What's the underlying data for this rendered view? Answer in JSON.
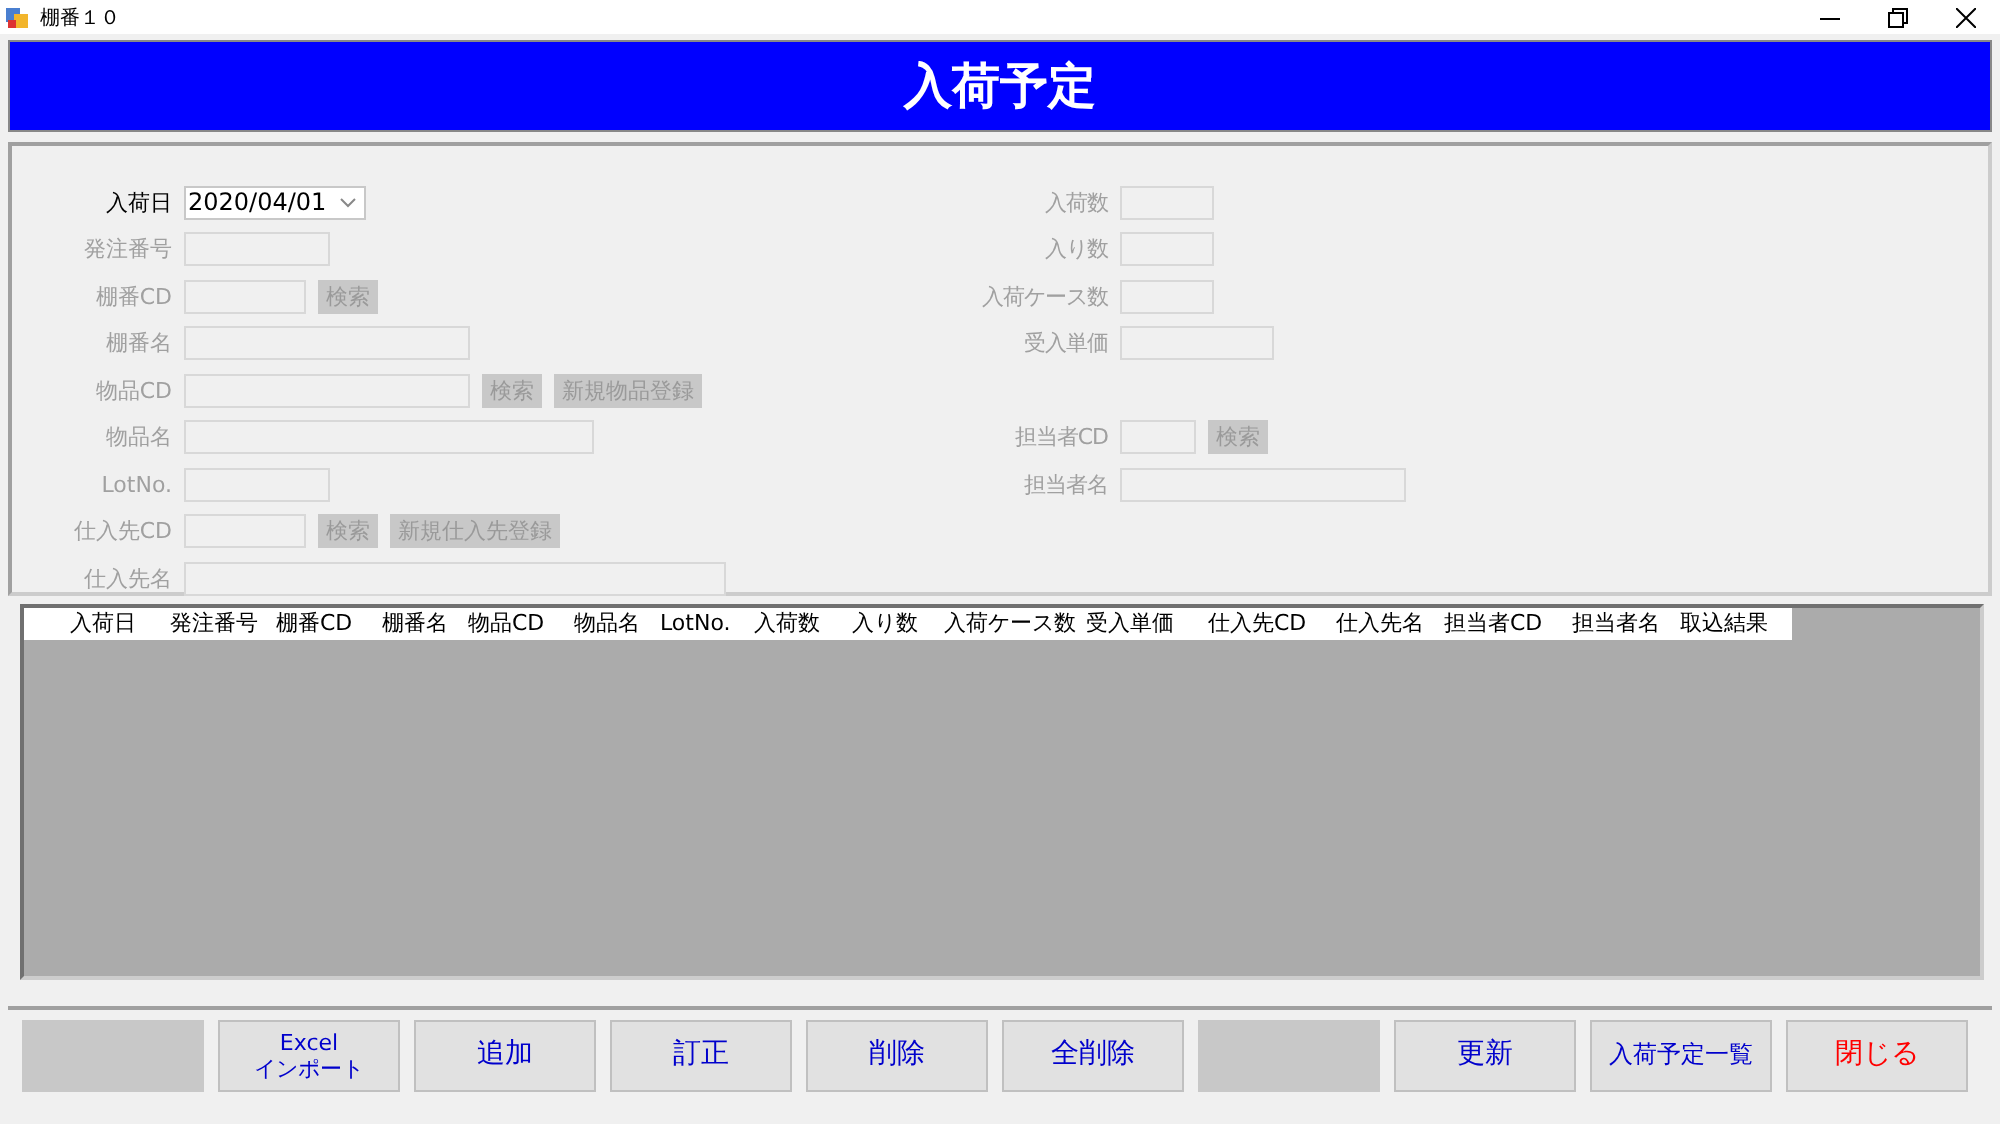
{
  "window": {
    "title": "棚番１０"
  },
  "header": {
    "title": "入荷予定"
  },
  "form": {
    "left": [
      {
        "label": "入荷日",
        "disabled": false,
        "kind": "date",
        "value": "2020/04/01"
      },
      {
        "label": "発注番号",
        "disabled": true,
        "kind": "text"
      },
      {
        "label": "棚番CD",
        "disabled": true,
        "kind": "text",
        "buttons": [
          {
            "label": "検索",
            "disabled": true
          }
        ]
      },
      {
        "label": "棚番名",
        "disabled": true,
        "kind": "text"
      },
      {
        "label": "物品CD",
        "disabled": true,
        "kind": "text",
        "buttons": [
          {
            "label": "検索",
            "disabled": true
          },
          {
            "label": "新規物品登録",
            "disabled": true
          }
        ]
      },
      {
        "label": "物品名",
        "disabled": true,
        "kind": "text"
      },
      {
        "label": "LotNo.",
        "disabled": true,
        "kind": "text"
      },
      {
        "label": "仕入先CD",
        "disabled": true,
        "kind": "text",
        "buttons": [
          {
            "label": "検索",
            "disabled": true
          },
          {
            "label": "新規仕入先登録",
            "disabled": true
          }
        ]
      },
      {
        "label": "仕入先名",
        "disabled": true,
        "kind": "text"
      }
    ],
    "right": [
      {
        "label": "入荷数",
        "disabled": true,
        "kind": "text"
      },
      {
        "label": "入り数",
        "disabled": true,
        "kind": "text"
      },
      {
        "label": "入荷ケース数",
        "disabled": true,
        "kind": "text"
      },
      {
        "label": "受入単価",
        "disabled": true,
        "kind": "text"
      },
      {
        "kind": "gap"
      },
      {
        "label": "担当者CD",
        "disabled": true,
        "kind": "text",
        "buttons": [
          {
            "label": "検索",
            "disabled": true
          }
        ]
      },
      {
        "label": "担当者名",
        "disabled": true,
        "kind": "text"
      }
    ]
  },
  "table": {
    "columns": [
      "入荷日",
      "発注番号",
      "棚番CD",
      "棚番名",
      "物品CD",
      "物品名",
      "LotNo.",
      "入荷数",
      "入り数",
      "入荷ケース数",
      "受入単価",
      "仕入先CD",
      "仕入先名",
      "担当者CD",
      "担当者名",
      "取込結果"
    ]
  },
  "footer": {
    "buttons": [
      {
        "kind": "blank"
      },
      {
        "kind": "button",
        "label": "Excel\nインポート",
        "color": "#0000cc"
      },
      {
        "kind": "button",
        "label": "追加",
        "color": "#0000cc"
      },
      {
        "kind": "button",
        "label": "訂正",
        "color": "#0000cc"
      },
      {
        "kind": "button",
        "label": "削除",
        "color": "#0000cc"
      },
      {
        "kind": "button",
        "label": "全削除",
        "color": "#0000cc"
      },
      {
        "kind": "blank"
      },
      {
        "kind": "button",
        "label": "更新",
        "color": "#0000cc"
      },
      {
        "kind": "button",
        "label": "入荷予定一覧",
        "color": "#0000cc"
      },
      {
        "kind": "button",
        "label": "閉じる",
        "color": "#ff0000"
      }
    ]
  }
}
